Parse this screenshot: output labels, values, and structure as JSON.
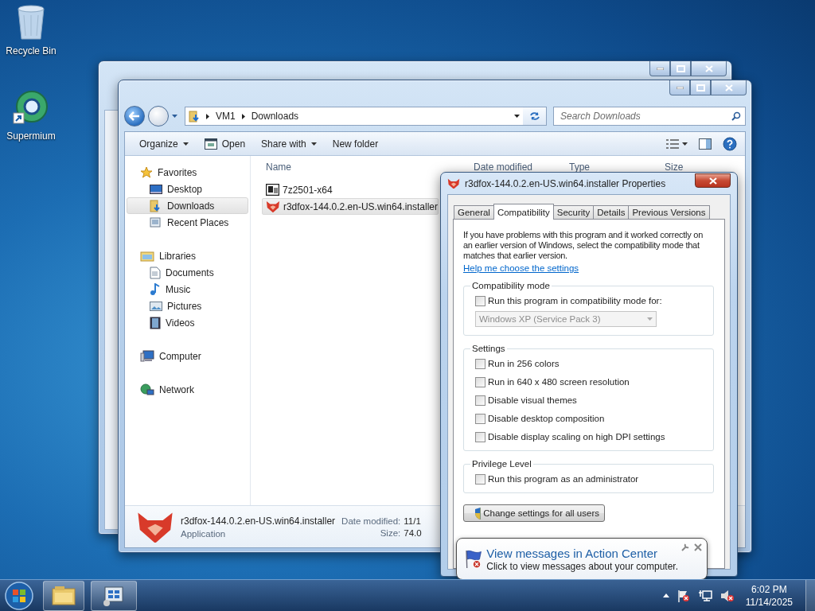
{
  "desktop_icons": [
    {
      "label": "Recycle Bin",
      "kind": "bin"
    },
    {
      "label": "Supermium",
      "kind": "browser"
    }
  ],
  "explorer": {
    "breadcrumb": [
      "VM1",
      "Downloads"
    ],
    "search": {
      "placeholder": "Search Downloads"
    },
    "toolbar": [
      {
        "label": "Organize",
        "kind": "menu"
      },
      {
        "label": "Open",
        "kind": "open"
      },
      {
        "label": "Share with",
        "kind": "menu"
      },
      {
        "label": "New folder",
        "kind": "plain"
      }
    ],
    "nav": [
      {
        "label": "Favorites",
        "kind": "star",
        "selected": false,
        "children": [
          {
            "label": "Desktop",
            "kind": "desktop",
            "selected": false
          },
          {
            "label": "Downloads",
            "kind": "downloads",
            "selected": true
          },
          {
            "label": "Recent Places",
            "kind": "recent",
            "selected": false
          }
        ]
      },
      {
        "label": "Libraries",
        "kind": "library",
        "selected": false,
        "children": [
          {
            "label": "Documents",
            "kind": "documents",
            "selected": false
          },
          {
            "label": "Music",
            "kind": "music",
            "selected": false
          },
          {
            "label": "Pictures",
            "kind": "pictures",
            "selected": false
          },
          {
            "label": "Videos",
            "kind": "videos",
            "selected": false
          }
        ]
      },
      {
        "label": "Computer",
        "kind": "computer",
        "selected": false
      },
      {
        "label": "Network",
        "kind": "network",
        "selected": false
      }
    ],
    "columns": [
      "Name",
      "Date modified",
      "Type",
      "Size"
    ],
    "files": [
      {
        "name": "7z2501-x64",
        "kind": "archive",
        "selected": false
      },
      {
        "name": "r3dfox-144.0.2.en-US.win64.installer",
        "kind": "fox",
        "selected": true
      }
    ],
    "details": {
      "name": "r3dfox-144.0.2.en-US.win64.installer",
      "type": "Application",
      "date_label": "Date modified:",
      "date_value": "11/1",
      "size_label": "Size:",
      "size_value": "74.0"
    }
  },
  "properties": {
    "title": "r3dfox-144.0.2.en-US.win64.installer Properties",
    "tabs": [
      {
        "label": "General",
        "selected": false
      },
      {
        "label": "Compatibility",
        "selected": true
      },
      {
        "label": "Security",
        "selected": false
      },
      {
        "label": "Details",
        "selected": false
      },
      {
        "label": "Previous Versions",
        "selected": false
      }
    ],
    "intro": "If you have problems with this program and it worked correctly on an earlier version of Windows, select the compatibility mode that matches that earlier version.",
    "help_link": "Help me choose the settings",
    "groups": [
      {
        "title": "Compatibility mode",
        "items": [
          {
            "kind": "checkbox",
            "label": "Run this program in compatibility mode for:",
            "checked": false
          },
          {
            "kind": "select",
            "value": "Windows XP (Service Pack 3)",
            "disabled": true
          }
        ]
      },
      {
        "title": "Settings",
        "items": [
          {
            "kind": "checkbox",
            "label": "Run in 256 colors",
            "checked": false
          },
          {
            "kind": "checkbox",
            "label": "Run in 640 x 480 screen resolution",
            "checked": false
          },
          {
            "kind": "checkbox",
            "label": "Disable visual themes",
            "checked": false
          },
          {
            "kind": "checkbox",
            "label": "Disable desktop composition",
            "checked": false
          },
          {
            "kind": "checkbox",
            "label": "Disable display scaling on high DPI settings",
            "checked": false
          }
        ]
      },
      {
        "title": "Privilege Level",
        "items": [
          {
            "kind": "checkbox",
            "label": "Run this program as an administrator",
            "checked": false
          }
        ]
      }
    ],
    "all_users_button": "Change settings for all users"
  },
  "balloon": {
    "title": "View messages in Action Center",
    "text": "Click to view messages about your computer."
  },
  "tray": {
    "time": "6:02 PM",
    "date": "11/14/2025"
  }
}
